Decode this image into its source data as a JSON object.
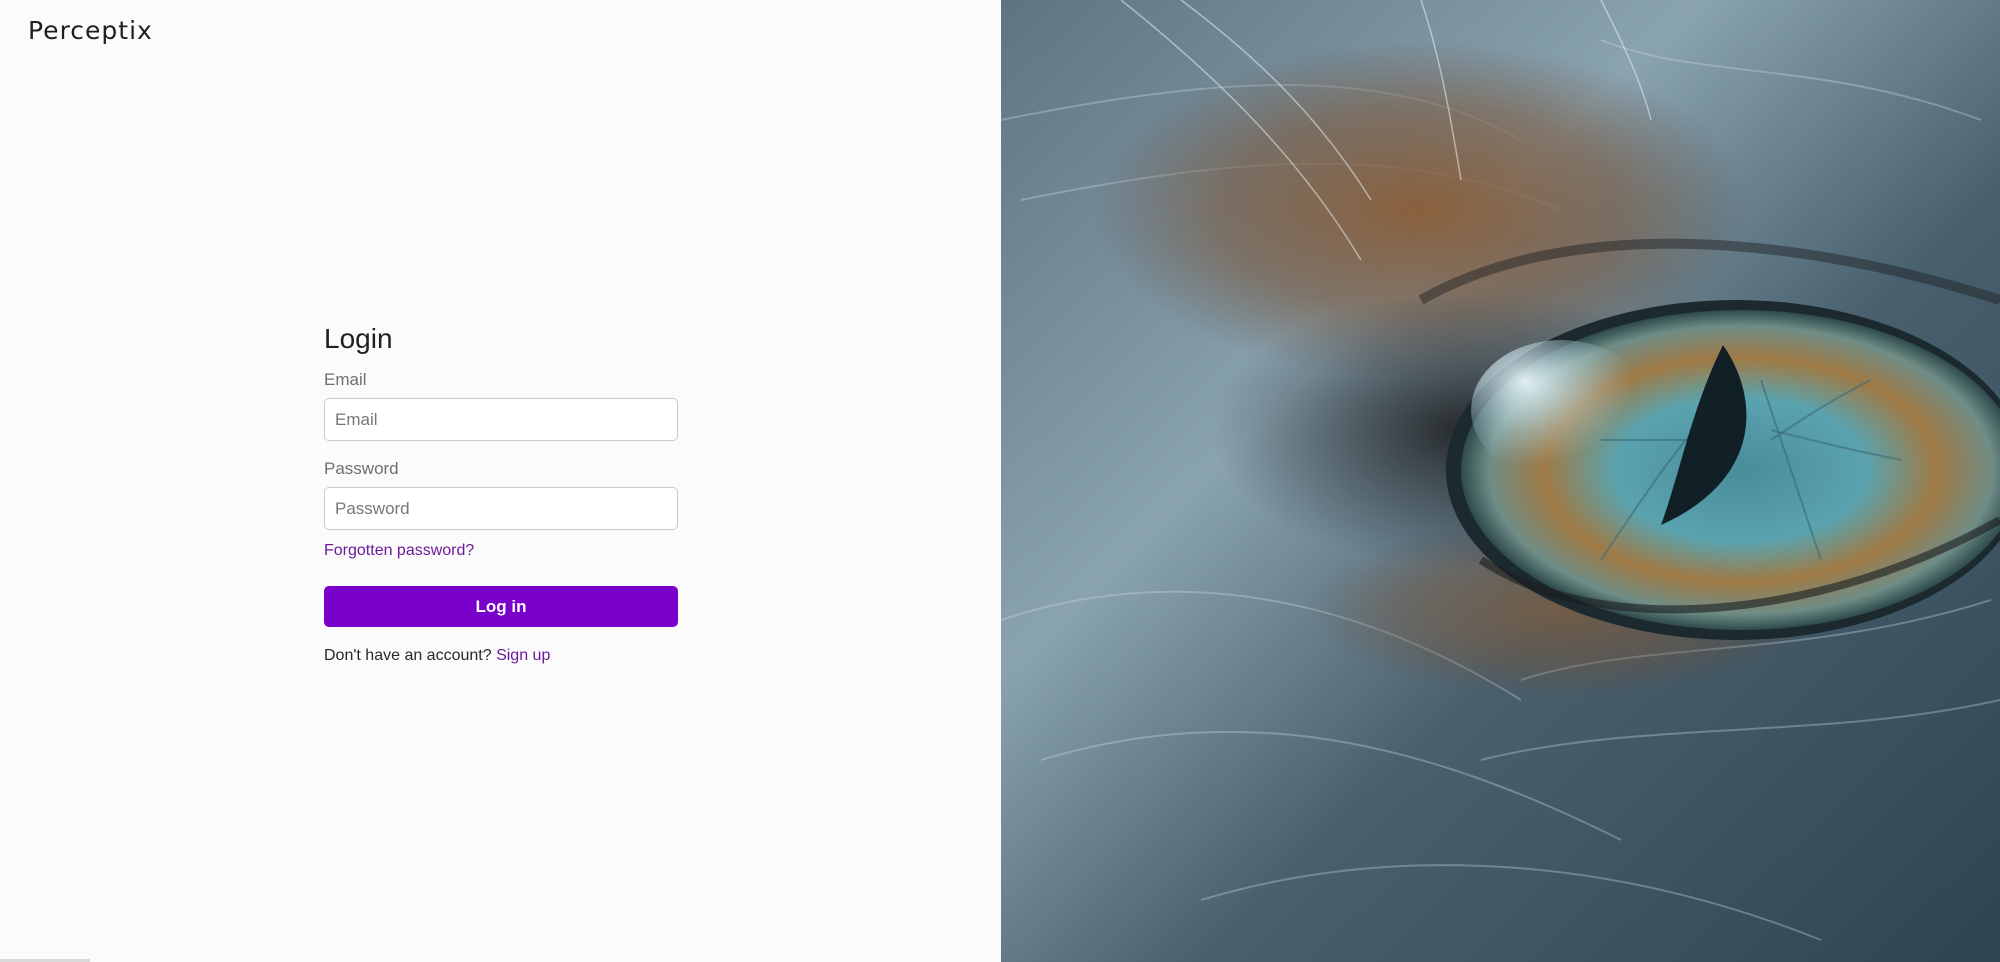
{
  "brand": {
    "name": "Perceptix"
  },
  "login": {
    "title": "Login",
    "email_label": "Email",
    "email_placeholder": "Email",
    "email_value": "",
    "password_label": "Password",
    "password_placeholder": "Password",
    "password_value": "",
    "forgot_link": "Forgotten password?",
    "submit_label": "Log in",
    "signup_prompt": "Don't have an account?",
    "signup_link": "Sign up"
  },
  "hero_image": {
    "subject": "cat-eye-closeup"
  },
  "colors": {
    "accent": "#7a00cc",
    "link": "#6a1b9a",
    "background": "#fcfbfb"
  }
}
